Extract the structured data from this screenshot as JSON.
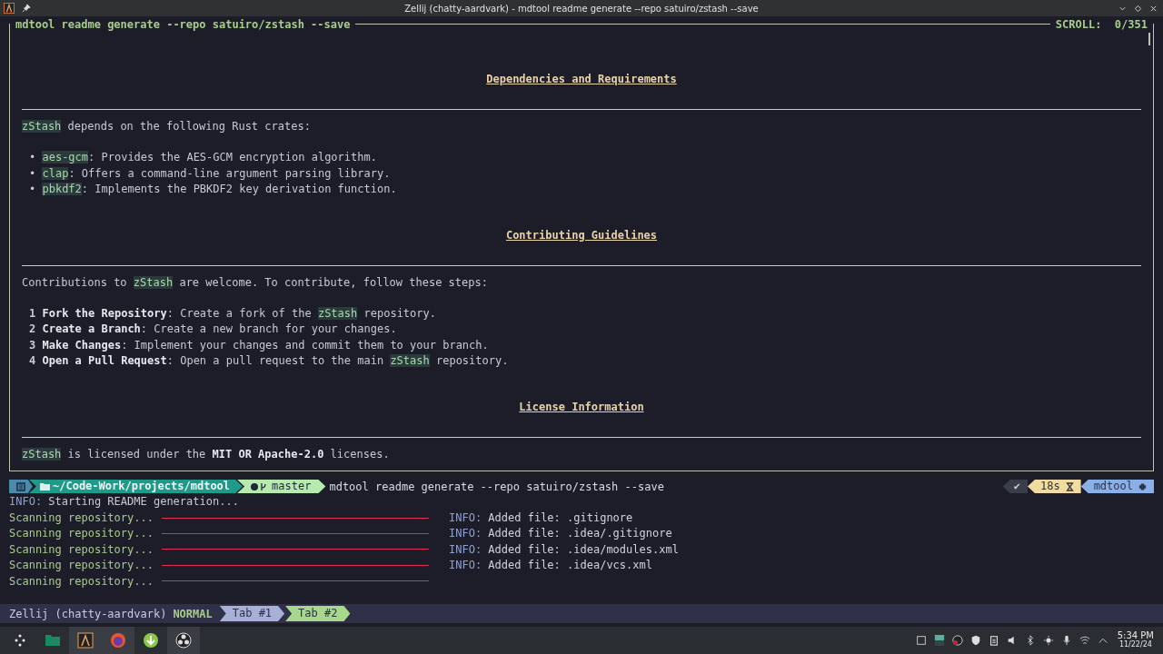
{
  "window": {
    "title": "Zellij (chatty-aardvark) - mdtool readme generate --repo satuiro/zstash --save"
  },
  "pane": {
    "title": "mdtool readme generate --repo satuiro/zstash --save",
    "scroll": "SCROLL:  0/351"
  },
  "readme": [
    {
      "kind": "heading",
      "text": "Dependencies and Requirements"
    },
    {
      "kind": "paragraph",
      "segments": [
        {
          "kind": "code",
          "text": "zStash"
        },
        {
          "kind": "plain",
          "text": " depends on the following Rust crates:"
        }
      ]
    },
    {
      "kind": "bullets",
      "items": [
        {
          "marker": "•",
          "segments": [
            {
              "kind": "code",
              "text": "aes-gcm"
            },
            {
              "kind": "plain",
              "text": ": Provides the AES-GCM encryption algorithm."
            }
          ]
        },
        {
          "marker": "•",
          "segments": [
            {
              "kind": "code",
              "text": "clap"
            },
            {
              "kind": "plain",
              "text": ": Offers a command-line argument parsing library."
            }
          ]
        },
        {
          "marker": "•",
          "segments": [
            {
              "kind": "code",
              "text": "pbkdf2"
            },
            {
              "kind": "plain",
              "text": ": Implements the PBKDF2 key derivation function."
            }
          ]
        }
      ]
    },
    {
      "kind": "heading",
      "text": "Contributing Guidelines"
    },
    {
      "kind": "paragraph",
      "segments": [
        {
          "kind": "plain",
          "text": "Contributions to "
        },
        {
          "kind": "code",
          "text": "zStash"
        },
        {
          "kind": "plain",
          "text": " are welcome. To contribute, follow these steps:"
        }
      ]
    },
    {
      "kind": "numbered",
      "items": [
        {
          "number": "1",
          "segments": [
            {
              "kind": "bold",
              "text": "Fork the Repository"
            },
            {
              "kind": "plain",
              "text": ": Create a fork of the "
            },
            {
              "kind": "code",
              "text": "zStash"
            },
            {
              "kind": "plain",
              "text": " repository."
            }
          ]
        },
        {
          "number": "2",
          "segments": [
            {
              "kind": "bold",
              "text": "Create a Branch"
            },
            {
              "kind": "plain",
              "text": ": Create a new branch for your changes."
            }
          ]
        },
        {
          "number": "3",
          "segments": [
            {
              "kind": "bold",
              "text": "Make Changes"
            },
            {
              "kind": "plain",
              "text": ": Implement your changes and commit them to your branch."
            }
          ]
        },
        {
          "number": "4",
          "segments": [
            {
              "kind": "bold",
              "text": "Open a Pull Request"
            },
            {
              "kind": "plain",
              "text": ": Open a pull request to the main "
            },
            {
              "kind": "code",
              "text": "zStash"
            },
            {
              "kind": "plain",
              "text": " repository."
            }
          ]
        }
      ]
    },
    {
      "kind": "heading",
      "text": "License Information"
    },
    {
      "kind": "paragraph",
      "segments": [
        {
          "kind": "code",
          "text": "zStash"
        },
        {
          "kind": "plain",
          "text": " is licensed under the "
        },
        {
          "kind": "bold",
          "text": "MIT OR Apache-2.0"
        },
        {
          "kind": "plain",
          "text": " licenses."
        }
      ]
    }
  ],
  "prompt": {
    "path": "~/Code-Work/projects/mdtool",
    "branch": "master",
    "command": "mdtool readme generate --repo satuiro/zstash --save",
    "status": "✔",
    "duration": "18s",
    "project": "mdtool"
  },
  "log_start": {
    "level": "INFO:",
    "text": " Starting README generation..."
  },
  "scan_rows": [
    {
      "label": "Scanning repository...",
      "level": 1,
      "info": {
        "level": "INFO:",
        "text": " Added file: .gitignore"
      }
    },
    {
      "label": "Scanning repository...",
      "level": 1,
      "info": {
        "level": "INFO:",
        "text": " Added file: .idea/.gitignore"
      }
    },
    {
      "label": "Scanning repository...",
      "level": 1,
      "info": {
        "level": "INFO:",
        "text": " Added file: .idea/modules.xml"
      }
    },
    {
      "label": "Scanning repository...",
      "level": 1,
      "info": {
        "level": "INFO:",
        "text": " Added file: .idea/vcs.xml"
      }
    },
    {
      "label": "Scanning repository...",
      "level": 1
    }
  ],
  "tab_bar": {
    "session": "Zellij (chatty-aardvark)",
    "mode": "NORMAL",
    "tabs": [
      {
        "label": "Tab #1",
        "selected": false
      },
      {
        "label": "Tab #2",
        "selected": true
      }
    ]
  },
  "taskbar": {
    "time": "5:34 PM",
    "date": "11/22/24"
  }
}
